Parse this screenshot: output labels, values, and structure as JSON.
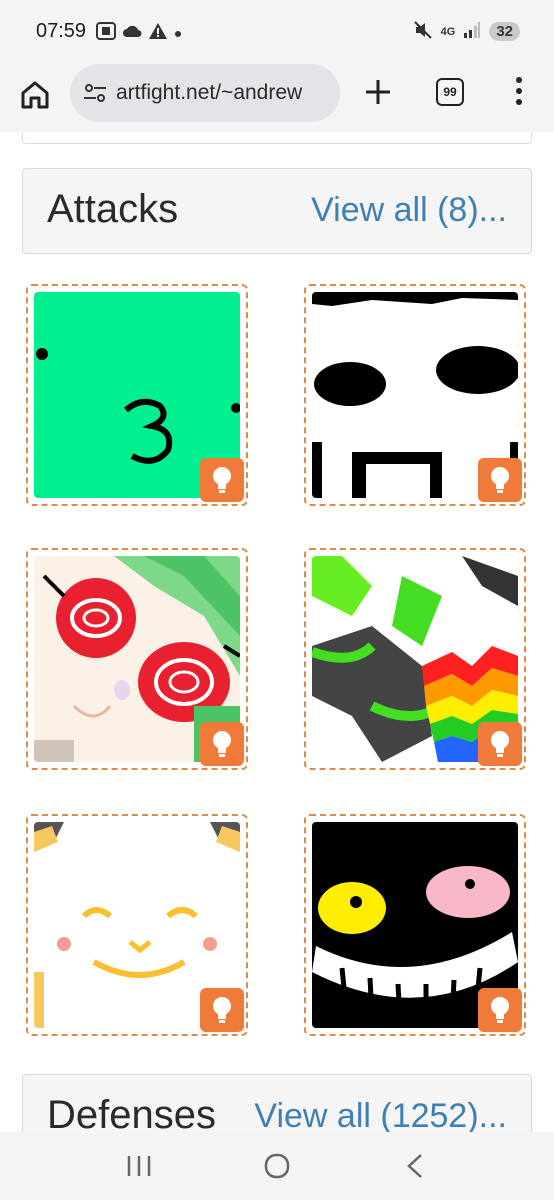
{
  "status": {
    "time": "07:59",
    "network": "4G",
    "battery": "32"
  },
  "browser": {
    "url": "artfight.net/~andrew",
    "tab_count": "99"
  },
  "attacks": {
    "title": "Attacks",
    "view_all": "View all (8)..."
  },
  "defenses": {
    "title": "Defenses",
    "view_all": "View all (1252)..."
  },
  "colors": {
    "accent_orange": "#f07a3a",
    "link_blue": "#3f7fb1",
    "dashed_border": "#e08a4a"
  },
  "icons": {
    "badge": "lightbulb-icon",
    "home": "home-icon",
    "add": "plus-icon",
    "menu": "more-vert-icon"
  }
}
